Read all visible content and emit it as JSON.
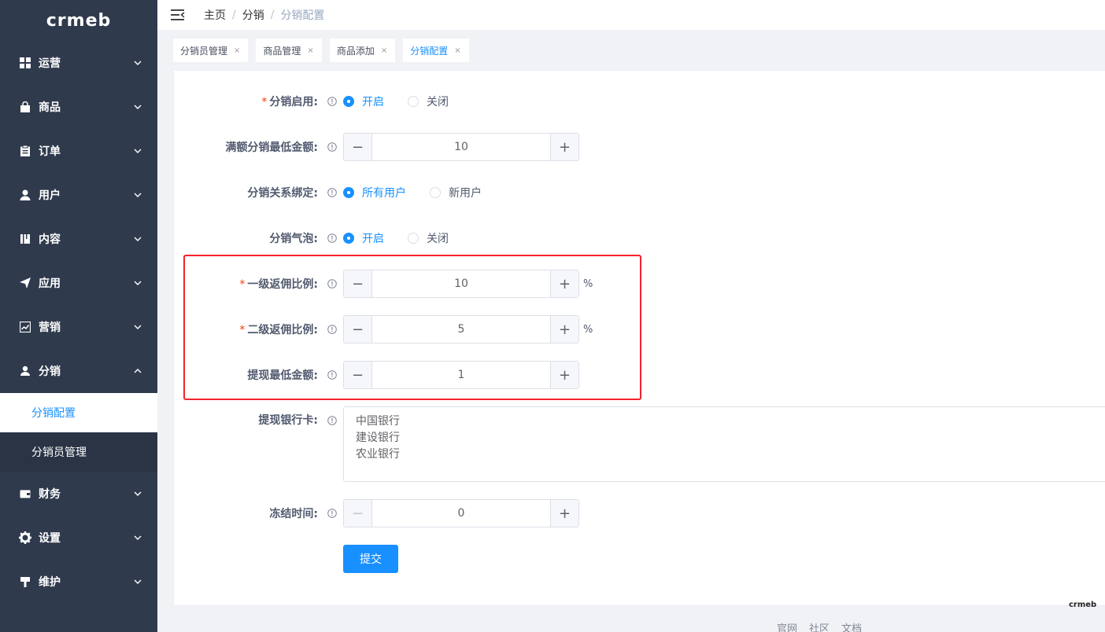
{
  "sidebar": {
    "logo": "crmeb",
    "menu": [
      {
        "label": "运营",
        "icon": "grid-icon"
      },
      {
        "label": "商品",
        "icon": "shopping-bag-icon"
      },
      {
        "label": "订单",
        "icon": "clipboard-icon"
      },
      {
        "label": "用户",
        "icon": "user-icon"
      },
      {
        "label": "内容",
        "icon": "book-icon"
      },
      {
        "label": "应用",
        "icon": "send-icon"
      },
      {
        "label": "营销",
        "icon": "trend-chart-icon"
      },
      {
        "label": "分销",
        "icon": "user-group-icon"
      }
    ],
    "submenu": [
      {
        "label": "分销配置"
      },
      {
        "label": "分销员管理"
      }
    ],
    "menu_after": [
      {
        "label": "财务",
        "icon": "wallet-icon"
      },
      {
        "label": "设置",
        "icon": "gear-icon"
      },
      {
        "label": "维护",
        "icon": "hammer-icon"
      }
    ]
  },
  "breadcrumb": {
    "items": [
      "主页",
      "分销",
      "分销配置"
    ],
    "separator": "/"
  },
  "tabs": [
    {
      "label": "分销员管理",
      "close": "×"
    },
    {
      "label": "商品管理",
      "close": "×"
    },
    {
      "label": "商品添加",
      "close": "×"
    },
    {
      "label": "分销配置",
      "close": "×"
    }
  ],
  "form": {
    "enable": {
      "required": "*",
      "label": "分销启用:",
      "options": [
        "开启",
        "关闭"
      ],
      "selected": "开启"
    },
    "min_amount": {
      "label": "满额分销最低金额:",
      "minus": "−",
      "plus": "+",
      "value": "10"
    },
    "binding": {
      "label": "分销关系绑定:",
      "options": [
        "所有用户",
        "新用户"
      ],
      "selected": "所有用户"
    },
    "bubble": {
      "label": "分销气泡:",
      "options": [
        "开启",
        "关闭"
      ],
      "selected": "开启"
    },
    "level1": {
      "required": "*",
      "label": "一级返佣比例:",
      "minus": "−",
      "plus": "+",
      "value": "10",
      "unit": "%"
    },
    "level2": {
      "required": "*",
      "label": "二级返佣比例:",
      "minus": "−",
      "plus": "+",
      "value": "5",
      "unit": "%"
    },
    "withdraw_min": {
      "label": "提现最低金额:",
      "minus": "−",
      "plus": "+",
      "value": "1"
    },
    "bank_cards": {
      "label": "提现银行卡:",
      "lines": [
        "中国银行",
        "建设银行",
        "农业银行"
      ]
    },
    "freeze_time": {
      "label": "冻结时间:",
      "minus": "−",
      "plus": "+",
      "value": "0"
    },
    "submit_label": "提交"
  },
  "footer": {
    "links": [
      "官网",
      "社区",
      "文档"
    ]
  },
  "colors": {
    "sidebar_bg": "#2f3a4d",
    "accent": "#1890ff",
    "highlight_border": "#f5222d"
  }
}
